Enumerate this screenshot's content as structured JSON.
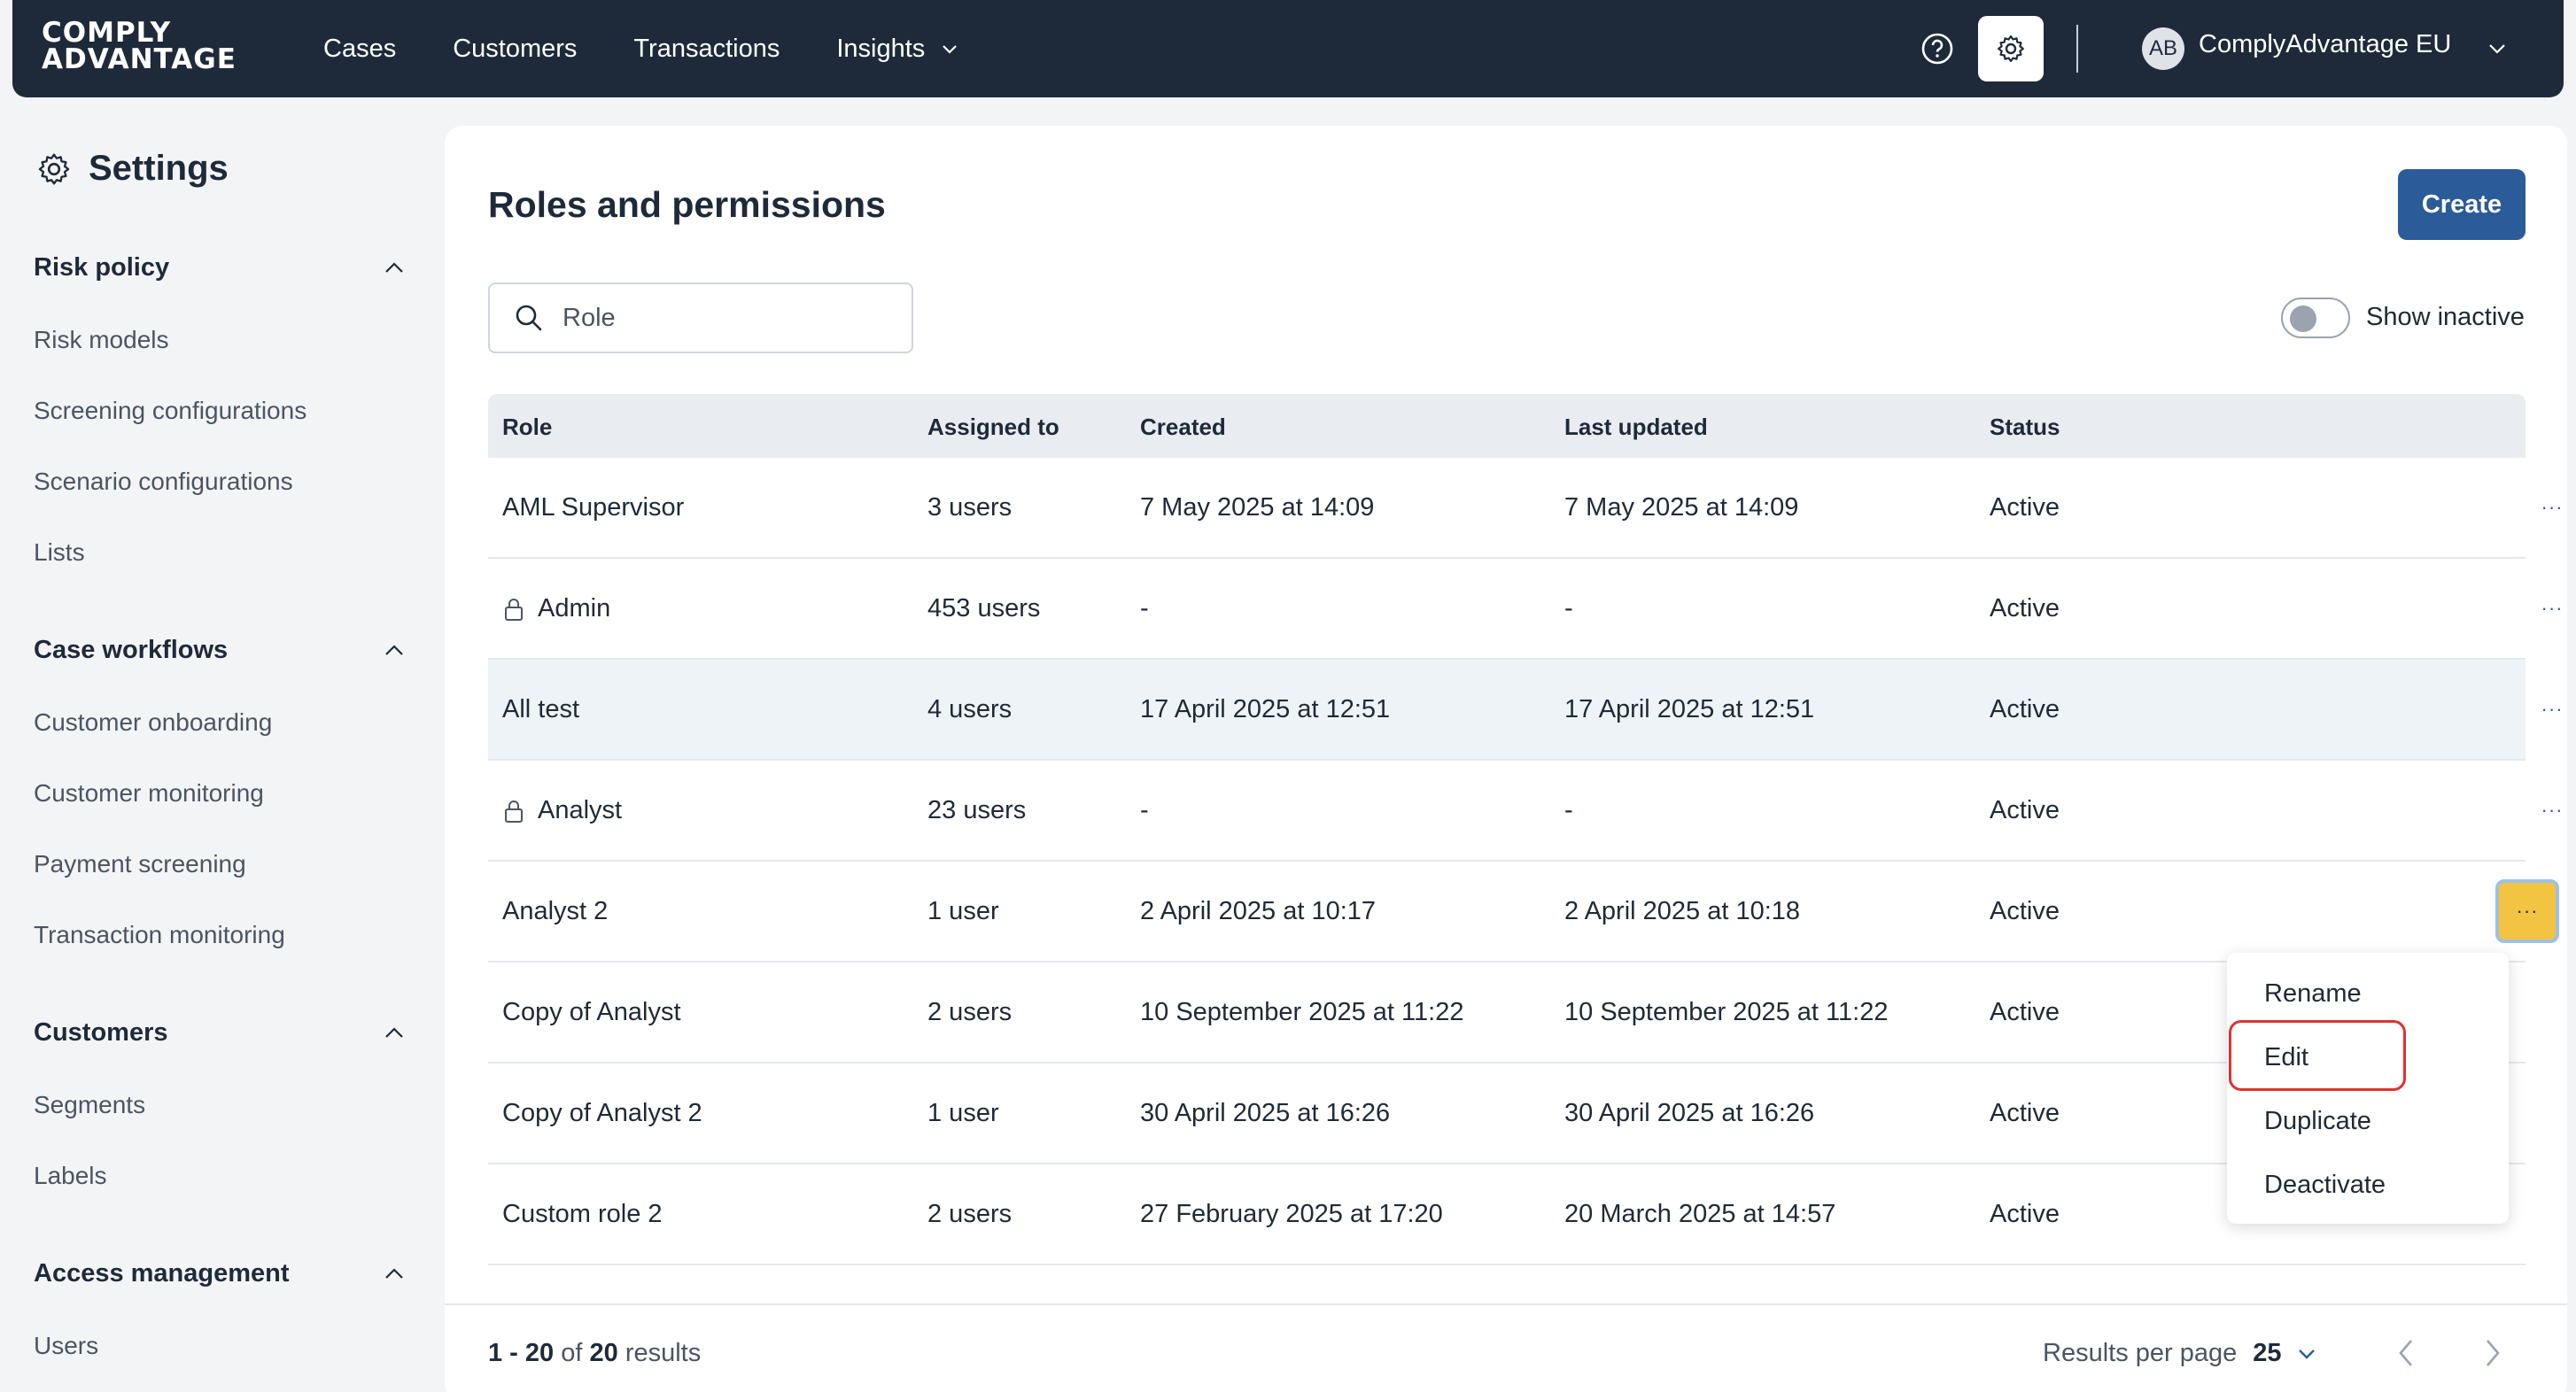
{
  "brand": {
    "line1": "COMPLY",
    "line2": "ADVANTAGE"
  },
  "nav": {
    "items": [
      {
        "label": "Cases"
      },
      {
        "label": "Customers"
      },
      {
        "label": "Transactions"
      },
      {
        "label": "Insights"
      }
    ],
    "avatar_initials": "AB",
    "org_name": "ComplyAdvantage EU"
  },
  "sidebar": {
    "title": "Settings",
    "sections": [
      {
        "label": "Risk policy",
        "items": [
          "Risk models",
          "Screening configurations",
          "Scenario configurations",
          "Lists"
        ]
      },
      {
        "label": "Case workflows",
        "items": [
          "Customer onboarding",
          "Customer monitoring",
          "Payment screening",
          "Transaction monitoring"
        ]
      },
      {
        "label": "Customers",
        "items": [
          "Segments",
          "Labels"
        ]
      },
      {
        "label": "Access management",
        "items": [
          "Users"
        ]
      }
    ]
  },
  "main": {
    "title": "Roles and permissions",
    "create_label": "Create",
    "search_placeholder": "Role",
    "show_inactive_label": "Show inactive",
    "show_inactive": false,
    "columns": [
      "Role",
      "Assigned to",
      "Created",
      "Last updated",
      "Status"
    ],
    "rows": [
      {
        "role": "AML Supervisor",
        "locked": false,
        "assigned": "3 users",
        "created": "7 May 2025 at 14:09",
        "updated": "7 May 2025 at 14:09",
        "status": "Active"
      },
      {
        "role": "Admin",
        "locked": true,
        "assigned": "453 users",
        "created": "-",
        "updated": "-",
        "status": "Active"
      },
      {
        "role": "All test",
        "locked": false,
        "assigned": "4 users",
        "created": "17 April 2025 at 12:51",
        "updated": "17 April 2025 at 12:51",
        "status": "Active"
      },
      {
        "role": "Analyst",
        "locked": true,
        "assigned": "23 users",
        "created": "-",
        "updated": "-",
        "status": "Active"
      },
      {
        "role": "Analyst 2",
        "locked": false,
        "assigned": "1 user",
        "created": "2 April 2025 at 10:17",
        "updated": "2 April 2025 at 10:18",
        "status": "Active"
      },
      {
        "role": "Copy of Analyst",
        "locked": false,
        "assigned": "2 users",
        "created": "10 September 2025 at 11:22",
        "updated": "10 September 2025 at 11:22",
        "status": "Active"
      },
      {
        "role": "Copy of Analyst 2",
        "locked": false,
        "assigned": "1 user",
        "created": "30 April 2025 at 16:26",
        "updated": "30 April 2025 at 16:26",
        "status": "Active"
      },
      {
        "role": "Custom role 2",
        "locked": false,
        "assigned": "2 users",
        "created": "27 February 2025 at 17:20",
        "updated": "20 March 2025 at 14:57",
        "status": "Active"
      }
    ],
    "more_glyph": "···",
    "context_menu": [
      "Rename",
      "Edit",
      "Duplicate",
      "Deactivate"
    ],
    "footer": {
      "range": "1 - 20",
      "of": "of",
      "total": "20",
      "results_word": "results",
      "rpp_label": "Results per page",
      "rpp_value": "25"
    }
  },
  "colors": {
    "nav_bg": "#1e2a3a",
    "primary": "#2b5c99",
    "active_more": "#f3c441",
    "focus_ring": "#e0322f"
  }
}
